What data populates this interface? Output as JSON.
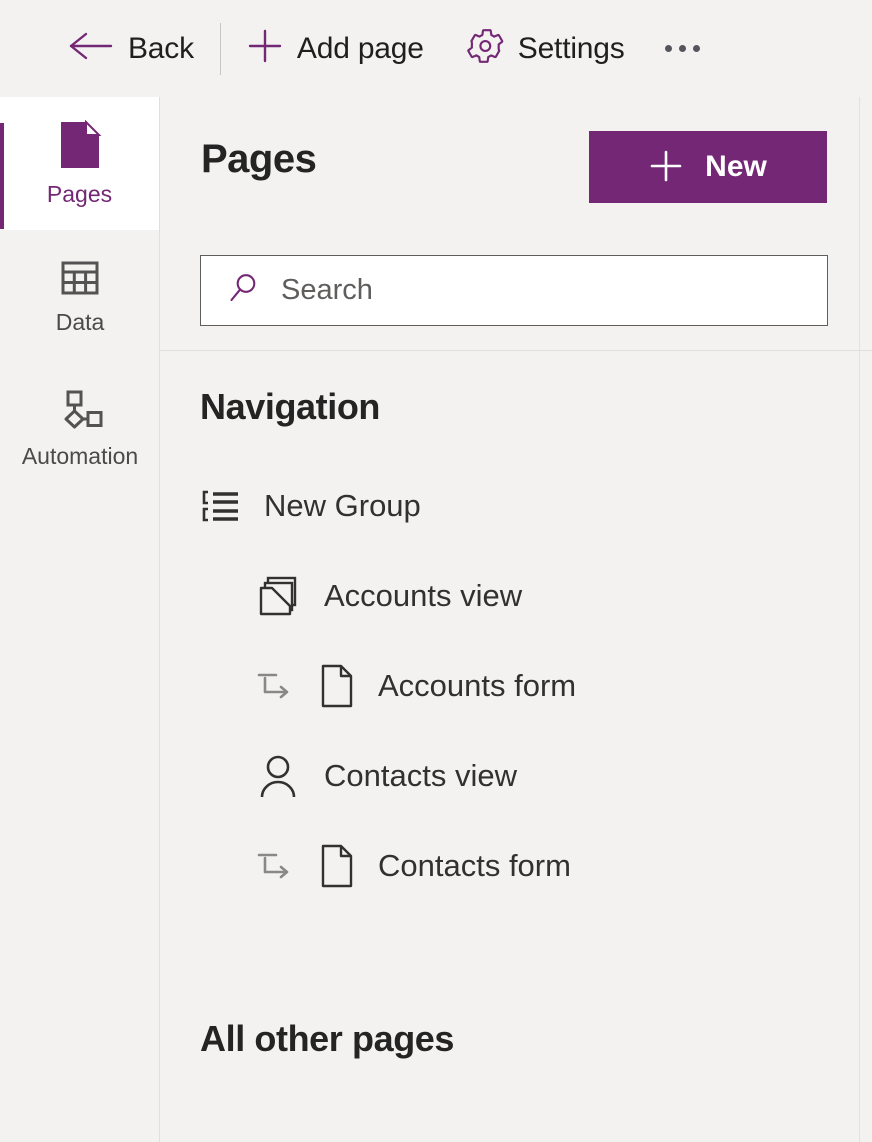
{
  "toolbar": {
    "back": {
      "label": "Back",
      "icon": "arrow-left-icon"
    },
    "add_page": {
      "label": "Add page",
      "icon": "plus-icon"
    },
    "settings": {
      "label": "Settings",
      "icon": "gear-icon"
    },
    "more": {
      "icon": "ellipsis-icon"
    }
  },
  "rail": {
    "items": [
      {
        "label": "Pages",
        "icon": "page-document-icon",
        "selected": true
      },
      {
        "label": "Data",
        "icon": "table-grid-icon",
        "selected": false
      },
      {
        "label": "Automation",
        "icon": "flowchart-icon",
        "selected": false
      }
    ]
  },
  "main": {
    "title": "Pages",
    "new_button": {
      "label": "New",
      "icon": "plus-icon"
    },
    "search": {
      "placeholder": "Search",
      "value": "",
      "icon": "search-icon"
    },
    "navigation_heading": "Navigation",
    "all_other_pages_heading": "All other pages",
    "tree": [
      {
        "label": "New Group",
        "icon": "group-list-icon",
        "level": 0,
        "has_indent_arrow": false
      },
      {
        "label": "Accounts view",
        "icon": "view-stack-icon",
        "level": 1,
        "has_indent_arrow": false
      },
      {
        "label": "Accounts form",
        "icon": "form-page-icon",
        "level": 2,
        "has_indent_arrow": true
      },
      {
        "label": "Contacts view",
        "icon": "person-icon",
        "level": 1,
        "has_indent_arrow": false
      },
      {
        "label": "Contacts form",
        "icon": "form-page-icon",
        "level": 2,
        "has_indent_arrow": true
      }
    ]
  },
  "colors": {
    "brand_purple": "#742774",
    "canvas": "#f3f2f1",
    "selected_bg": "#ffffff",
    "text_primary": "#242424",
    "text_secondary": "#605e5c",
    "border": "#e1dfdd"
  }
}
